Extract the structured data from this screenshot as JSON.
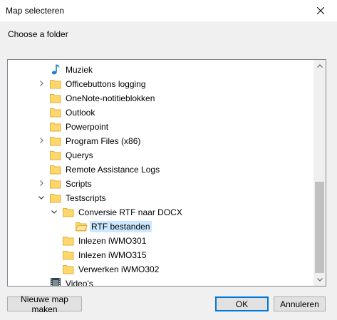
{
  "window": {
    "title": "Map selecteren"
  },
  "dialog": {
    "prompt": "Choose a folder"
  },
  "tree": {
    "items": [
      {
        "label": "Muziek",
        "icon": "music-note-icon",
        "expander": "none",
        "depth": 0
      },
      {
        "label": "Officebuttons logging",
        "icon": "folder-icon",
        "expander": "collapsed",
        "depth": 0
      },
      {
        "label": "OneNote-notitieblokken",
        "icon": "folder-icon",
        "expander": "none",
        "depth": 0
      },
      {
        "label": "Outlook",
        "icon": "folder-icon",
        "expander": "none",
        "depth": 0
      },
      {
        "label": "Powerpoint",
        "icon": "folder-icon",
        "expander": "none",
        "depth": 0
      },
      {
        "label": "Program Files (x86)",
        "icon": "folder-icon",
        "expander": "collapsed",
        "depth": 0
      },
      {
        "label": "Querys",
        "icon": "folder-icon",
        "expander": "none",
        "depth": 0
      },
      {
        "label": "Remote Assistance Logs",
        "icon": "folder-icon",
        "expander": "none",
        "depth": 0
      },
      {
        "label": "Scripts",
        "icon": "folder-icon",
        "expander": "collapsed",
        "depth": 0
      },
      {
        "label": "Testscripts",
        "icon": "folder-icon",
        "expander": "expanded",
        "depth": 0
      },
      {
        "label": "Conversie RTF naar DOCX",
        "icon": "folder-icon",
        "expander": "expanded",
        "depth": 1
      },
      {
        "label": "RTF bestanden",
        "icon": "folder-open-icon",
        "expander": "none",
        "depth": 2,
        "selected": true
      },
      {
        "label": "Inlezen iWMO301",
        "icon": "folder-icon",
        "expander": "none",
        "depth": 1
      },
      {
        "label": "Inlezen iWMO315",
        "icon": "folder-icon",
        "expander": "none",
        "depth": 1
      },
      {
        "label": "Verwerken iWMO302",
        "icon": "folder-icon",
        "expander": "none",
        "depth": 1
      },
      {
        "label": "Video's",
        "icon": "film-icon",
        "expander": "none",
        "depth": 0
      }
    ]
  },
  "buttons": {
    "new_folder": "Nieuwe map maken",
    "ok": "OK",
    "cancel": "Annuleren"
  },
  "colors": {
    "selection": "#cce8ff",
    "folder": "#ffd76a",
    "accent": "#0078d7"
  }
}
